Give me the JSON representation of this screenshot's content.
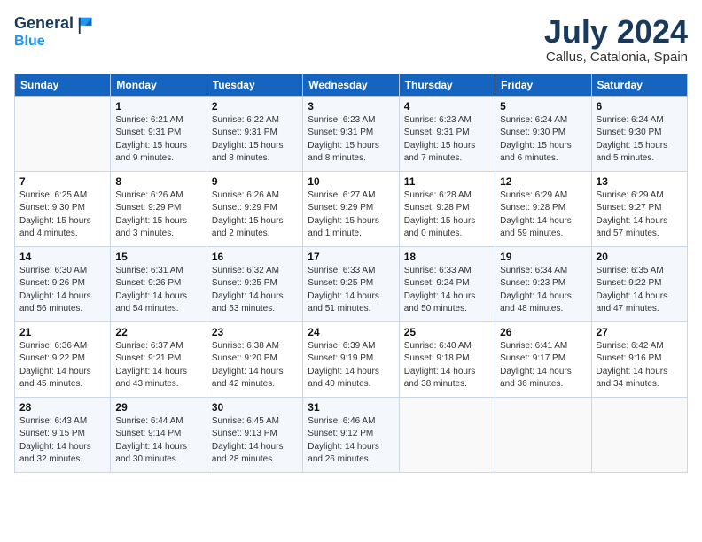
{
  "header": {
    "logo_line1": "General",
    "logo_line2": "Blue",
    "month": "July 2024",
    "location": "Callus, Catalonia, Spain"
  },
  "weekdays": [
    "Sunday",
    "Monday",
    "Tuesday",
    "Wednesday",
    "Thursday",
    "Friday",
    "Saturday"
  ],
  "weeks": [
    [
      {
        "day": "",
        "info": ""
      },
      {
        "day": "1",
        "info": "Sunrise: 6:21 AM\nSunset: 9:31 PM\nDaylight: 15 hours\nand 9 minutes."
      },
      {
        "day": "2",
        "info": "Sunrise: 6:22 AM\nSunset: 9:31 PM\nDaylight: 15 hours\nand 8 minutes."
      },
      {
        "day": "3",
        "info": "Sunrise: 6:23 AM\nSunset: 9:31 PM\nDaylight: 15 hours\nand 8 minutes."
      },
      {
        "day": "4",
        "info": "Sunrise: 6:23 AM\nSunset: 9:31 PM\nDaylight: 15 hours\nand 7 minutes."
      },
      {
        "day": "5",
        "info": "Sunrise: 6:24 AM\nSunset: 9:30 PM\nDaylight: 15 hours\nand 6 minutes."
      },
      {
        "day": "6",
        "info": "Sunrise: 6:24 AM\nSunset: 9:30 PM\nDaylight: 15 hours\nand 5 minutes."
      }
    ],
    [
      {
        "day": "7",
        "info": "Sunrise: 6:25 AM\nSunset: 9:30 PM\nDaylight: 15 hours\nand 4 minutes."
      },
      {
        "day": "8",
        "info": "Sunrise: 6:26 AM\nSunset: 9:29 PM\nDaylight: 15 hours\nand 3 minutes."
      },
      {
        "day": "9",
        "info": "Sunrise: 6:26 AM\nSunset: 9:29 PM\nDaylight: 15 hours\nand 2 minutes."
      },
      {
        "day": "10",
        "info": "Sunrise: 6:27 AM\nSunset: 9:29 PM\nDaylight: 15 hours\nand 1 minute."
      },
      {
        "day": "11",
        "info": "Sunrise: 6:28 AM\nSunset: 9:28 PM\nDaylight: 15 hours\nand 0 minutes."
      },
      {
        "day": "12",
        "info": "Sunrise: 6:29 AM\nSunset: 9:28 PM\nDaylight: 14 hours\nand 59 minutes."
      },
      {
        "day": "13",
        "info": "Sunrise: 6:29 AM\nSunset: 9:27 PM\nDaylight: 14 hours\nand 57 minutes."
      }
    ],
    [
      {
        "day": "14",
        "info": "Sunrise: 6:30 AM\nSunset: 9:26 PM\nDaylight: 14 hours\nand 56 minutes."
      },
      {
        "day": "15",
        "info": "Sunrise: 6:31 AM\nSunset: 9:26 PM\nDaylight: 14 hours\nand 54 minutes."
      },
      {
        "day": "16",
        "info": "Sunrise: 6:32 AM\nSunset: 9:25 PM\nDaylight: 14 hours\nand 53 minutes."
      },
      {
        "day": "17",
        "info": "Sunrise: 6:33 AM\nSunset: 9:25 PM\nDaylight: 14 hours\nand 51 minutes."
      },
      {
        "day": "18",
        "info": "Sunrise: 6:33 AM\nSunset: 9:24 PM\nDaylight: 14 hours\nand 50 minutes."
      },
      {
        "day": "19",
        "info": "Sunrise: 6:34 AM\nSunset: 9:23 PM\nDaylight: 14 hours\nand 48 minutes."
      },
      {
        "day": "20",
        "info": "Sunrise: 6:35 AM\nSunset: 9:22 PM\nDaylight: 14 hours\nand 47 minutes."
      }
    ],
    [
      {
        "day": "21",
        "info": "Sunrise: 6:36 AM\nSunset: 9:22 PM\nDaylight: 14 hours\nand 45 minutes."
      },
      {
        "day": "22",
        "info": "Sunrise: 6:37 AM\nSunset: 9:21 PM\nDaylight: 14 hours\nand 43 minutes."
      },
      {
        "day": "23",
        "info": "Sunrise: 6:38 AM\nSunset: 9:20 PM\nDaylight: 14 hours\nand 42 minutes."
      },
      {
        "day": "24",
        "info": "Sunrise: 6:39 AM\nSunset: 9:19 PM\nDaylight: 14 hours\nand 40 minutes."
      },
      {
        "day": "25",
        "info": "Sunrise: 6:40 AM\nSunset: 9:18 PM\nDaylight: 14 hours\nand 38 minutes."
      },
      {
        "day": "26",
        "info": "Sunrise: 6:41 AM\nSunset: 9:17 PM\nDaylight: 14 hours\nand 36 minutes."
      },
      {
        "day": "27",
        "info": "Sunrise: 6:42 AM\nSunset: 9:16 PM\nDaylight: 14 hours\nand 34 minutes."
      }
    ],
    [
      {
        "day": "28",
        "info": "Sunrise: 6:43 AM\nSunset: 9:15 PM\nDaylight: 14 hours\nand 32 minutes."
      },
      {
        "day": "29",
        "info": "Sunrise: 6:44 AM\nSunset: 9:14 PM\nDaylight: 14 hours\nand 30 minutes."
      },
      {
        "day": "30",
        "info": "Sunrise: 6:45 AM\nSunset: 9:13 PM\nDaylight: 14 hours\nand 28 minutes."
      },
      {
        "day": "31",
        "info": "Sunrise: 6:46 AM\nSunset: 9:12 PM\nDaylight: 14 hours\nand 26 minutes."
      },
      {
        "day": "",
        "info": ""
      },
      {
        "day": "",
        "info": ""
      },
      {
        "day": "",
        "info": ""
      }
    ]
  ]
}
